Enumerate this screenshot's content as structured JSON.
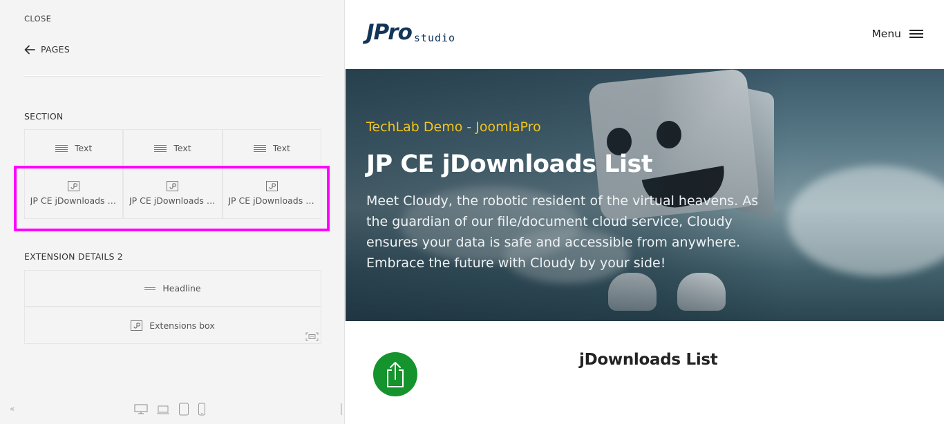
{
  "panel": {
    "close_label": "CLOSE",
    "back_label": "PAGES",
    "section1": {
      "title": "SECTION",
      "row1": [
        "Text",
        "Text",
        "Text"
      ],
      "row2": [
        "JP CE jDownloads List",
        "JP CE jDownloads List",
        "JP CE jDownloads List"
      ]
    },
    "section2": {
      "title": "EXTENSION DETAILS 2",
      "headline_label": "Headline",
      "extensions_label": "Extensions box"
    },
    "highlight_color": "#ff00ff"
  },
  "preview": {
    "logo_main": "JPro",
    "logo_sub": "studio",
    "menu_label": "Menu",
    "hero": {
      "kicker": "TechLab Demo - JoomlaPro",
      "title": "JP CE jDownloads List",
      "text": "Meet Cloudy, the robotic resident of the virtual heavens. As the guardian of our file/document cloud service, Cloudy ensures your data is safe and accessible from anywhere. Embrace the future with Cloudy by your side!"
    },
    "section_title": "jDownloads List",
    "colors": {
      "brand": "#123559",
      "kicker": "#f5c518",
      "download_icon_bg": "#15932c"
    }
  }
}
